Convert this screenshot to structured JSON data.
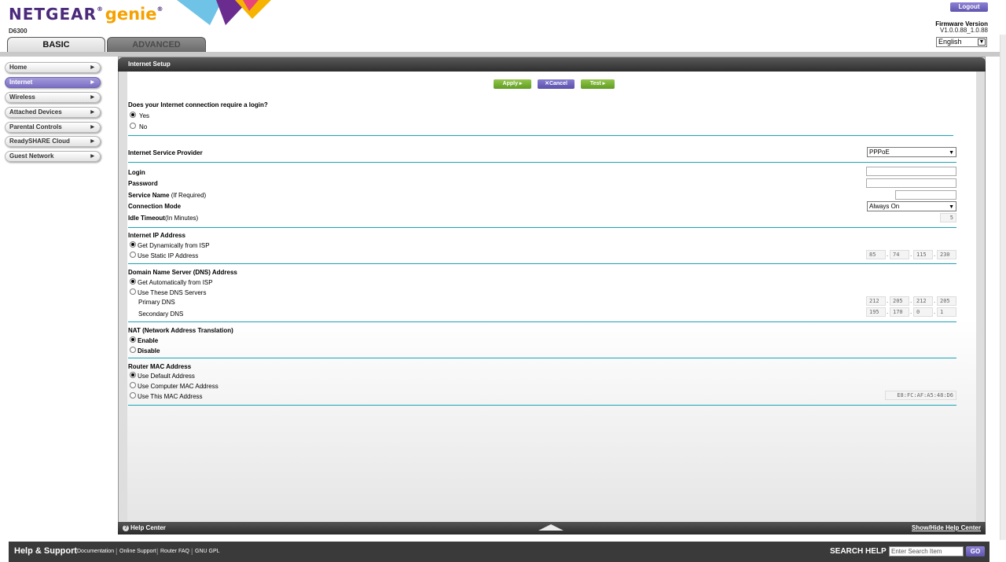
{
  "header": {
    "brand": "NETGEAR",
    "product": "genie",
    "reg": "®",
    "model": "D6300",
    "logout_label": "Logout",
    "firmware_label": "Firmware Version",
    "firmware_value": "V1.0.0.88_1.0.88",
    "language": "English",
    "tabs": [
      {
        "label": "BASIC"
      },
      {
        "label": "ADVANCED"
      }
    ]
  },
  "sidebar": {
    "items": [
      {
        "label": "Home"
      },
      {
        "label": "Internet"
      },
      {
        "label": "Wireless"
      },
      {
        "label": "Attached Devices"
      },
      {
        "label": "Parental Controls"
      },
      {
        "label": "ReadySHARE Cloud"
      },
      {
        "label": "Guest Network"
      }
    ],
    "active_index": 1
  },
  "panel": {
    "title": "Internet Setup",
    "buttons": {
      "apply": "Apply ▸",
      "cancel": "Cancel",
      "cancel_icon": "✕",
      "test": "Test ▸"
    },
    "login_question": "Does your Internet connection require a login?",
    "login_options": [
      "Yes",
      "No"
    ],
    "isp_label": "Internet Service Provider",
    "isp_value": "PPPoE",
    "login_label": "Login",
    "password_label": "Password",
    "service_name_label": "Service Name",
    "service_name_hint": "(If Required)",
    "connection_mode_label": "Connection Mode",
    "connection_mode_value": "Always On",
    "idle_timeout_label": "Idle Timeout",
    "idle_timeout_hint": "(In Minutes)",
    "idle_timeout_value": "5",
    "ip_section": "Internet IP Address",
    "ip_options": [
      "Get Dynamically from ISP",
      "Use Static IP Address"
    ],
    "static_ip": [
      "85",
      "74",
      "115",
      "230"
    ],
    "dns_section": "Domain Name Server (DNS) Address",
    "dns_options": [
      "Get Automatically from ISP",
      "Use These DNS Servers"
    ],
    "primary_dns_label": "Primary DNS",
    "primary_dns": [
      "212",
      "205",
      "212",
      "205"
    ],
    "secondary_dns_label": "Secondary DNS",
    "secondary_dns": [
      "195",
      "170",
      "0",
      "1"
    ],
    "nat_section": "NAT (Network Address Translation)",
    "nat_options": [
      "Enable",
      "Disable"
    ],
    "mac_section": "Router MAC Address",
    "mac_options": [
      "Use Default Address",
      "Use Computer MAC Address",
      "Use This MAC Address"
    ],
    "mac_value": "E8:FC:AF:A5:48:D6",
    "footer_help": "Help Center",
    "footer_toggle": "Show/Hide Help Center"
  },
  "bottom_bar": {
    "title": "Help & Support",
    "links": [
      "Documentation",
      "Online Support",
      "Router FAQ",
      "GNU GPL"
    ],
    "search_label": "SEARCH HELP",
    "search_placeholder": "Enter Search Item",
    "go_label": "GO"
  },
  "colors": {
    "brand_purple": "#4b2a7b",
    "genie_orange": "#f6a100",
    "active_nav": "#7a6fc3",
    "apply_green": "#5f9c22",
    "divider": "#1aa3b8"
  }
}
